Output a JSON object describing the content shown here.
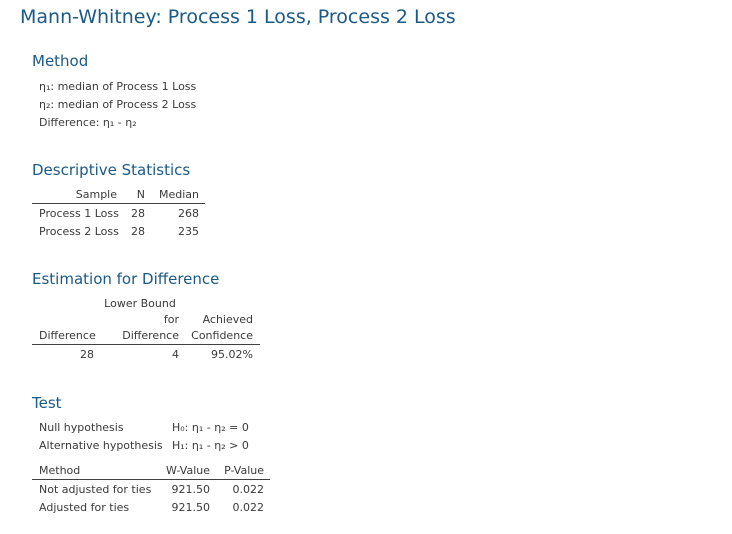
{
  "title": "Mann-Whitney: Process 1 Loss, Process 2 Loss",
  "method": {
    "heading": "Method",
    "lines": [
      "η₁: median of Process 1 Loss",
      "η₂: median of Process 2 Loss",
      "Difference: η₁ - η₂"
    ]
  },
  "descriptive": {
    "heading": "Descriptive Statistics",
    "columns": [
      "Sample",
      "N",
      "Median"
    ],
    "rows": [
      [
        "Process 1 Loss",
        "28",
        "268"
      ],
      [
        "Process 2 Loss",
        "28",
        "235"
      ]
    ]
  },
  "estimation": {
    "heading": "Estimation for Difference",
    "col1": "Difference",
    "col2_lines": [
      "Lower Bound",
      "for",
      "Difference"
    ],
    "col3_lines": [
      "Achieved",
      "Confidence"
    ],
    "row": [
      "28",
      "4",
      "95.02%"
    ]
  },
  "test": {
    "heading": "Test",
    "null_label": "Null hypothesis",
    "null_value": "H₀: η₁ - η₂ = 0",
    "alt_label": "Alternative hypothesis",
    "alt_value": "H₁: η₁ - η₂ > 0",
    "columns": [
      "Method",
      "W-Value",
      "P-Value"
    ],
    "rows": [
      [
        "Not adjusted for ties",
        "921.50",
        "0.022"
      ],
      [
        "Adjusted for ties",
        "921.50",
        "0.022"
      ]
    ]
  }
}
